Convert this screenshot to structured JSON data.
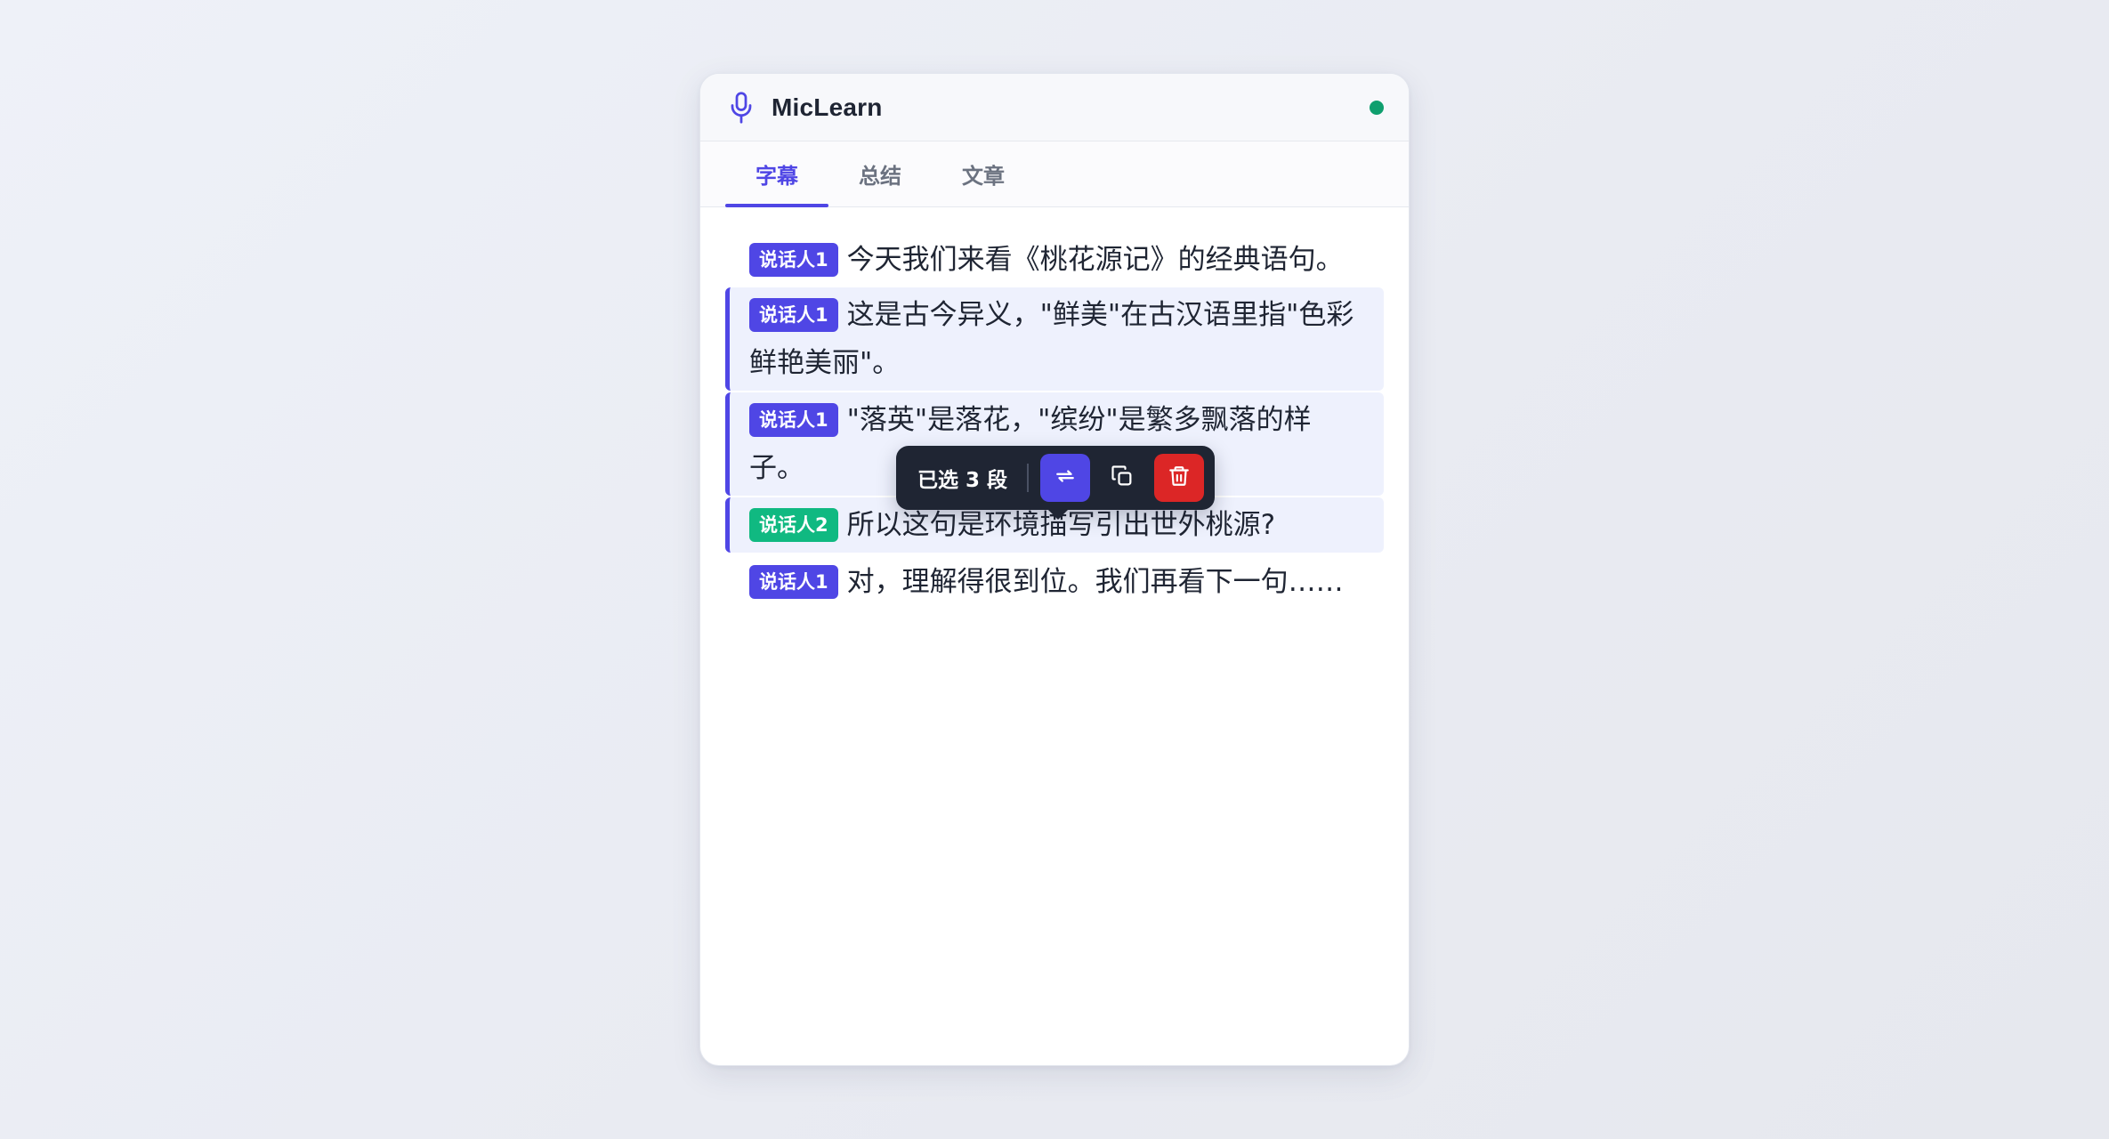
{
  "app": {
    "title": "MicLearn",
    "status_color": "#0f9f6e",
    "accent_color": "#4f46e5"
  },
  "tabs": [
    {
      "label": "字幕",
      "active": true
    },
    {
      "label": "总结",
      "active": false
    },
    {
      "label": "文章",
      "active": false
    }
  ],
  "segments": [
    {
      "speaker": "说话人1",
      "speaker_color": "#4f46e5",
      "text": "今天我们来看《桃花源记》的经典语句。",
      "selected": false
    },
    {
      "speaker": "说话人1",
      "speaker_color": "#4f46e5",
      "text": "这是古今异义，\"鲜美\"在古汉语里指\"色彩鲜艳美丽\"。",
      "selected": true
    },
    {
      "speaker": "说话人1",
      "speaker_color": "#4f46e5",
      "text": "\"落英\"是落花，\"缤纷\"是繁多飘落的样子。",
      "selected": true
    },
    {
      "speaker": "说话人2",
      "speaker_color": "#10b981",
      "text": "所以这句是环境描写引出世外桃源?",
      "selected": true
    },
    {
      "speaker": "说话人1",
      "speaker_color": "#4f46e5",
      "text": "对，理解得很到位。我们再看下一句……",
      "selected": false
    }
  ],
  "selection_toolbar": {
    "count_label": "已选 3 段",
    "buttons": [
      {
        "icon": "merge-icon",
        "color": "#4f46e5"
      },
      {
        "icon": "copy-icon",
        "color": "transparent"
      },
      {
        "icon": "trash-icon",
        "color": "#dc2626"
      }
    ]
  }
}
